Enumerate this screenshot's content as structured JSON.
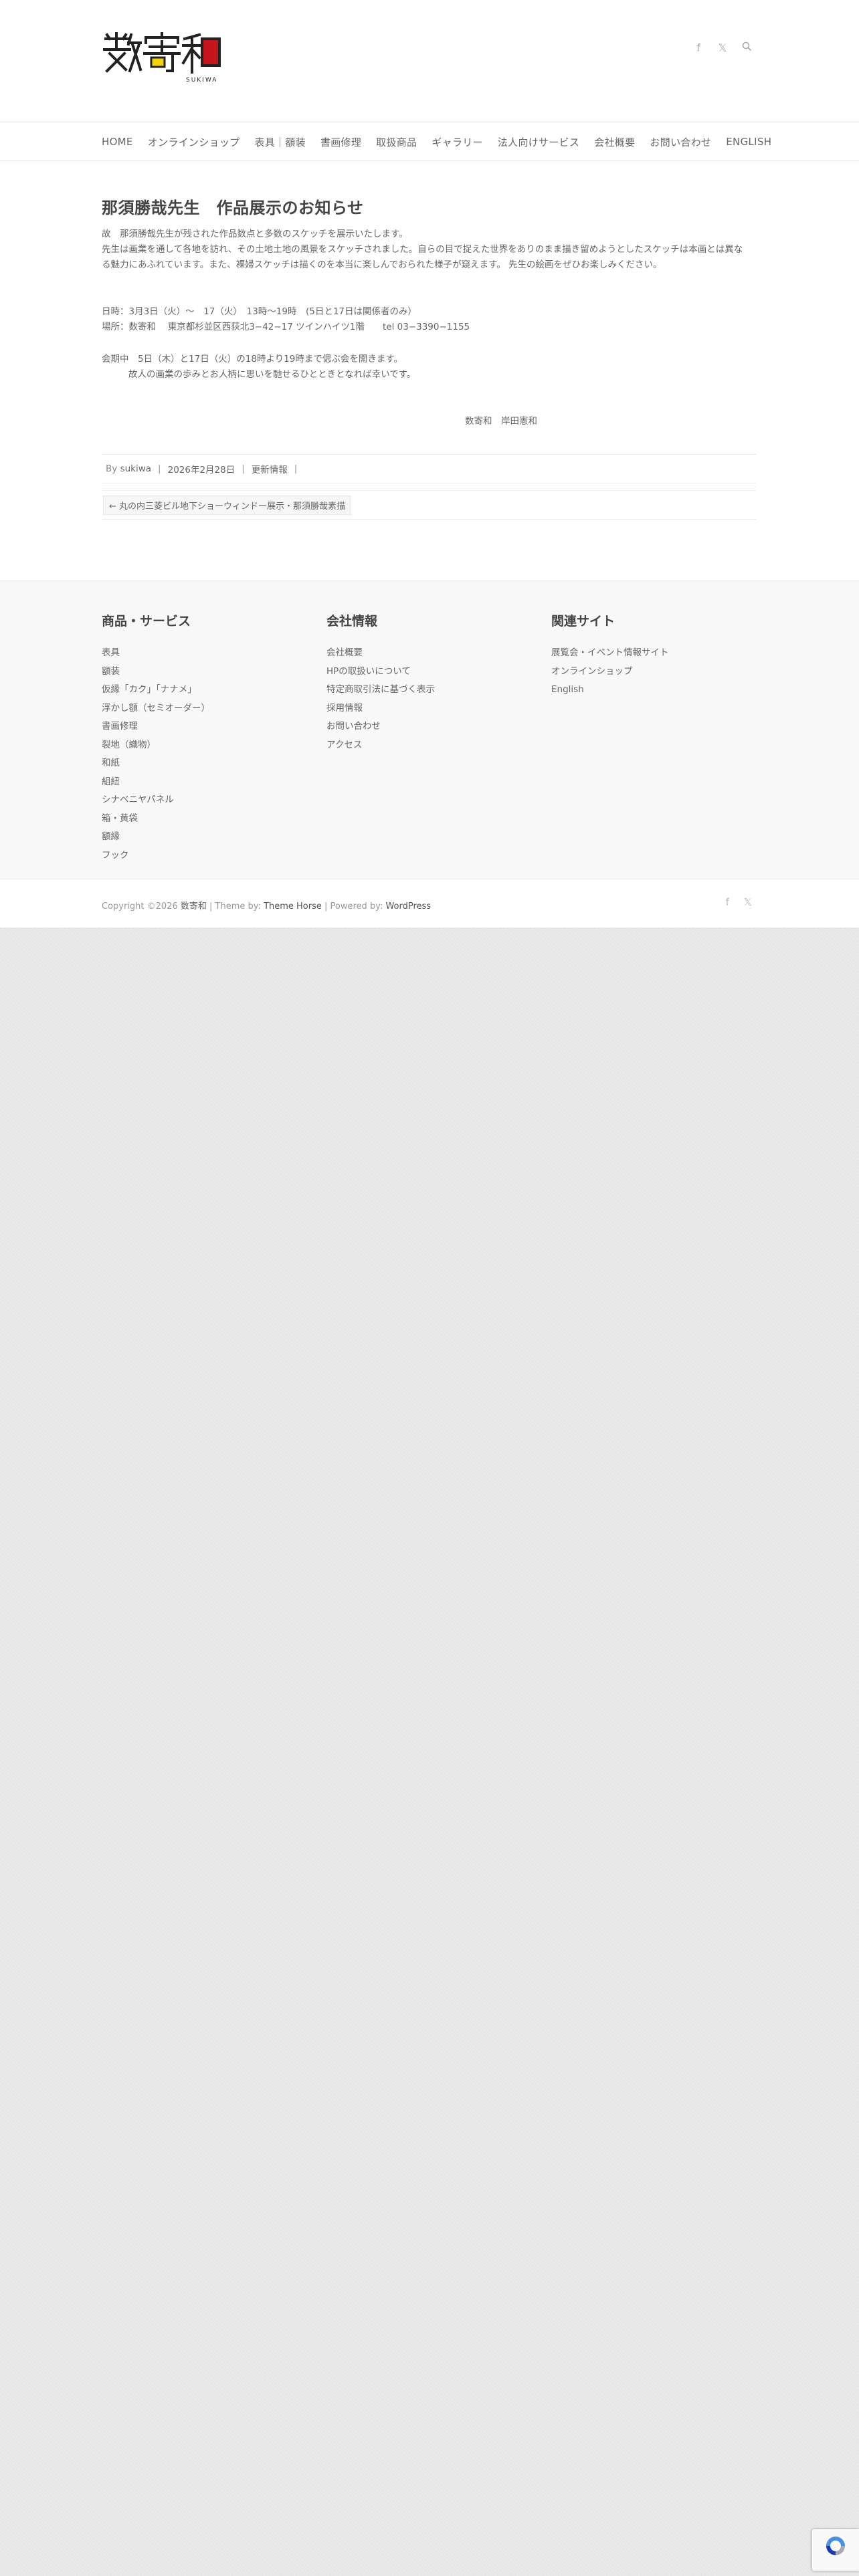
{
  "header": {
    "logo_text": "数寄和",
    "logo_sub": "SUKIWA",
    "social": [
      "facebook-icon",
      "x-icon",
      "search-icon"
    ]
  },
  "nav": {
    "items": [
      "HOME",
      "オンラインショップ",
      "表具｜額装",
      "書画修理",
      "取扱商品",
      "ギャラリー",
      "法人向けサービス",
      "会社概要",
      "お問い合わせ",
      "ENGLISH"
    ]
  },
  "post": {
    "title": "那須勝哉先生　作品展示のお知らせ",
    "lines": [
      "故　那須勝哉先生が残された作品数点と多数のスケッチを展示いたします。",
      "先生は画業を通して各地を訪れ、その土地土地の風景をスケッチされました。自らの目で捉えた世界をありのまま描き留めようとしたスケッチは本画とは異な",
      "る魅力にあふれています。また、裸婦スケッチは描くのを本当に楽しんでおられた様子が窺えます。 先生の絵画をぜひお楽しみください。"
    ],
    "schedule": [
      "日時：3月3日（火）〜　17（火）　13時〜19時　(5日と17日は関係者のみ）",
      "場所：数寄和　 東京都杉並区西荻北3−42−17 ツインハイツ1階　　tel 03−3390−1155"
    ],
    "event": [
      "会期中　5日（木）と17日（火）の18時より19時まで偲ぶ会を開きます。",
      "故人の画業の歩みとお人柄に思いを馳せるひとときとなれば幸いです。"
    ],
    "signature": "数寄和　岸田憲和",
    "meta": {
      "by_prefix": "By",
      "author": "sukiwa",
      "date": "2026年2月28日",
      "category": "更新情報"
    },
    "prev_link": "← 丸の内三菱ビル地下ショーウィンドー展示・那須勝哉素描"
  },
  "footer": {
    "col1": {
      "title": "商品・サービス",
      "items": [
        "表具",
        "額装",
        "仮縁「カク」「ナナメ」",
        "浮かし額（セミオーダー）",
        "書画修理",
        "裂地（織物）",
        "和紙",
        "組紐",
        "シナベニヤパネル",
        "箱・黄袋",
        "額縁",
        "フック"
      ]
    },
    "col2": {
      "title": "会社情報",
      "items": [
        "会社概要",
        "HPの取扱いについて",
        "特定商取引法に基づく表示",
        "採用情報",
        "お問い合わせ",
        "アクセス"
      ]
    },
    "col3": {
      "title": "関連サイト",
      "items": [
        "展覧会・イベント情報サイト",
        "オンラインショップ",
        "English"
      ]
    },
    "copyright": {
      "prefix": "Copyright ©2026",
      "site": "数寄和",
      "theme_prefix": "| Theme by:",
      "theme": "Theme Horse",
      "powered_prefix": "| Powered by:",
      "powered": "WordPress"
    }
  },
  "colors": {
    "logo_red": "#c4161c",
    "logo_yellow": "#f2d30c",
    "text": "#666666",
    "title": "#444444"
  }
}
